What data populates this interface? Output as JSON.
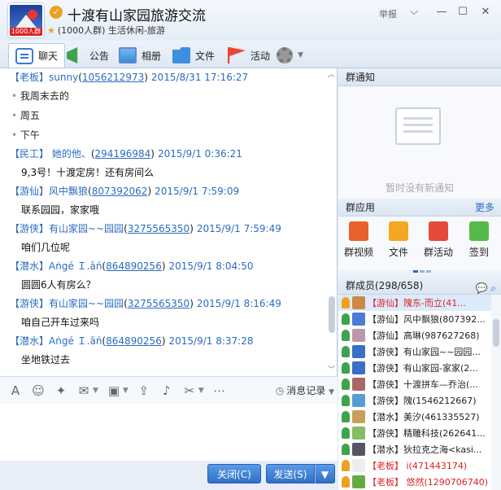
{
  "header": {
    "group_name": "十渡有山家园旅游交流",
    "logo_text": "1000人群",
    "subtitle": "(1000人群) 生活休闲-旅游",
    "report_label": "举报",
    "minimize": "—",
    "maximize": "☐",
    "close": "✕",
    "menu": "⌵"
  },
  "tabs": [
    {
      "label": "聊天",
      "icon": "chat-icon"
    },
    {
      "label": "公告",
      "icon": "announcement-icon"
    },
    {
      "label": "相册",
      "icon": "photo-icon"
    },
    {
      "label": "文件",
      "icon": "folder-icon"
    },
    {
      "label": "活动",
      "icon": "flag-icon"
    }
  ],
  "chat": {
    "messages": [
      {
        "title": "【老板】",
        "name": "sunny",
        "qq": "1056212973",
        "time": "2015/8/31 17:16:27",
        "lines": [
          "我周末去的",
          "周五",
          "下午"
        ],
        "bulleted": true
      },
      {
        "title": "【民工】",
        "name": "   她的他、",
        "qq": "294196984",
        "time": "2015/9/1 0:36:21",
        "lines": [
          "9,3号！十渡定房！还有房间么"
        ]
      },
      {
        "title": "【游仙】",
        "name": "风中飘狼",
        "qq": "807392062",
        "time": "2015/9/1 7:59:09",
        "lines": [
          "联系园园，家家哦"
        ]
      },
      {
        "title": "【游侠】",
        "name": "有山家园~~园园",
        "qq": "3275565350",
        "time": "2015/9/1 7:59:49",
        "lines": [
          "咱们几位呢"
        ]
      },
      {
        "title": "【潜水】",
        "name": "Aṅgé Ｉ.āń",
        "qq": "864890256",
        "time": "2015/9/1 8:04:50",
        "lines": [
          "圆圆6人有房么？"
        ]
      },
      {
        "title": "【游侠】",
        "name": "有山家园~~园园",
        "qq": "3275565350",
        "time": "2015/9/1 8:16:49",
        "lines": [
          "咱自己开车过来吗"
        ]
      },
      {
        "title": "【潜水】",
        "name": "Aṅgé Ｉ.āń",
        "qq": "864890256",
        "time": "2015/9/1 8:37:28",
        "lines": [
          "坐地铁过去"
        ]
      }
    ]
  },
  "toolbar": {
    "history_label": "消息记录"
  },
  "buttons": {
    "close_label": "关闭(C)",
    "send_label": "发送(S)",
    "send_dropdown": "▼"
  },
  "right": {
    "notice_title": "群通知",
    "notice_empty": "暂时没有新通知",
    "apps_title": "群应用",
    "apps_more": "更多",
    "apps": [
      {
        "label": "群视频",
        "color": "#e8612c"
      },
      {
        "label": "文件",
        "color": "#f5a623"
      },
      {
        "label": "群活动",
        "color": "#e64a3a"
      },
      {
        "label": "签到",
        "color": "#57b947"
      }
    ],
    "members_title": "群成员(298/658)",
    "members": [
      {
        "name": "【游仙】隗东-而立(41...",
        "red": true,
        "sel": true,
        "role_color": "#f0a020",
        "av": "#c84"
      },
      {
        "name": "【游仙】风中飘狼(807392...",
        "red": false,
        "role_color": "#3fa34d",
        "av": "#4a7bd6"
      },
      {
        "name": "【游仙】高琳(987627268)",
        "red": false,
        "role_color": "#3fa34d",
        "av": "#b9a"
      },
      {
        "name": "【游侠】有山家园~~园园...",
        "red": false,
        "role_color": "#3fa34d",
        "av": "#3a6fc9"
      },
      {
        "name": "【游侠】有山家园-家家(2...",
        "red": false,
        "role_color": "#3fa34d",
        "av": "#3a6fc9"
      },
      {
        "name": "【游侠】十渡拼车—乔治(...",
        "red": false,
        "role_color": "#3fa34d",
        "av": "#a66"
      },
      {
        "name": "【游侠】隗(1546212667)",
        "red": false,
        "role_color": "#3fa34d",
        "av": "#5b9bd5"
      },
      {
        "name": "【潜水】美汐(461335527)",
        "red": false,
        "role_color": "#3fa34d",
        "av": "#c9a05a"
      },
      {
        "name": "【游侠】精雕科技(262641...",
        "red": false,
        "role_color": "#3fa34d",
        "av": "#8b6"
      },
      {
        "name": "【潜水】狄拉克之海<kasi...",
        "red": false,
        "role_color": "#3fa34d",
        "av": "#556"
      },
      {
        "name": "【老板】 i(471443174)",
        "red": true,
        "role_color": "#f0a020",
        "av": "#eee"
      },
      {
        "name": "【老板】 悠然(1290706740)",
        "red": true,
        "role_color": "#f0a020",
        "av": "#6a4"
      }
    ]
  }
}
